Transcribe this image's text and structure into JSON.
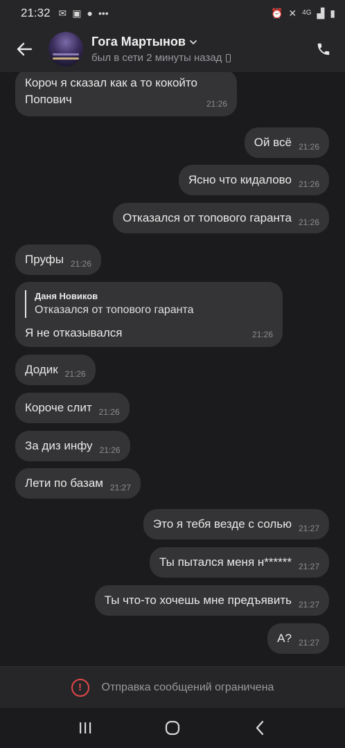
{
  "status_bar": {
    "time": "21:32",
    "network": "4G",
    "dots": "•••"
  },
  "header": {
    "contact_name": "Гога Мартынов",
    "status": "был в сети 2 минуты назад"
  },
  "messages": [
    {
      "dir": "in",
      "lines": [
        "Короч я сказал как а то кокойто",
        "Попович"
      ],
      "time": "21:26"
    },
    {
      "dir": "out",
      "text": "Ой всё",
      "time": "21:26"
    },
    {
      "dir": "out",
      "text": "Ясно что кидалово",
      "time": "21:26"
    },
    {
      "dir": "out",
      "text": "Отказался от топового гаранта",
      "time": "21:26"
    },
    {
      "dir": "in",
      "text": "Пруфы",
      "time": "21:26"
    },
    {
      "dir": "in",
      "reply_author": "Даня Новиков",
      "reply_text": "Отказался от топового гаранта",
      "text": "Я не отказывался",
      "time": "21:26"
    },
    {
      "dir": "in",
      "text": "Додик",
      "time": "21:26"
    },
    {
      "dir": "in",
      "text": "Короче слит",
      "time": "21:26"
    },
    {
      "dir": "in",
      "text": "За диз инфу",
      "time": "21:26"
    },
    {
      "dir": "in",
      "text": "Лети по базам",
      "time": "21:27"
    },
    {
      "dir": "out",
      "text": "Это я тебя везде с солью",
      "time": "21:27"
    },
    {
      "dir": "out",
      "text": "Ты пытался меня н******",
      "time": "21:27"
    },
    {
      "dir": "out",
      "text": "Ты что-то хочешь мне предъявить",
      "time": "21:27"
    },
    {
      "dir": "out",
      "text": "А?",
      "time": "21:27"
    }
  ],
  "restricted_notice": "Отправка сообщений ограничена",
  "colors": {
    "background": "#1b1b1d",
    "bubble": "#343436",
    "bar": "#262628",
    "warning": "#e2474b"
  }
}
